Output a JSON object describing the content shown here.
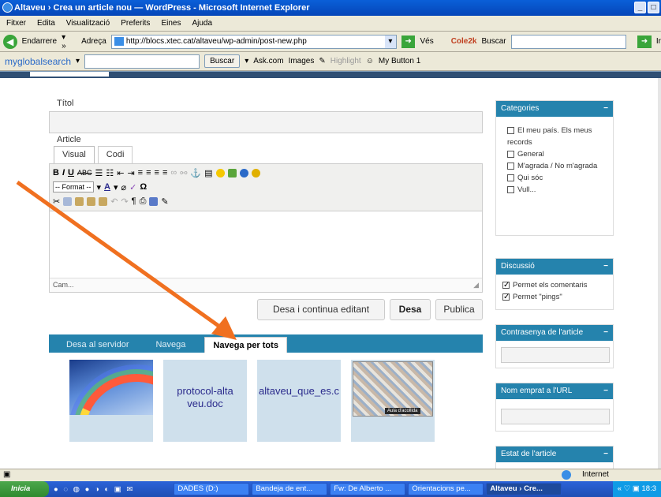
{
  "window": {
    "title": "Altaveu › Crea un article nou — WordPress - Microsoft Internet Explorer"
  },
  "menu": [
    "Fitxer",
    "Edita",
    "Visualització",
    "Preferits",
    "Eines",
    "Ajuda"
  ],
  "toolbar": {
    "back_label": "Endarrere",
    "address_label": "Adreça",
    "address_value": "http://blocs.xtec.cat/altaveu/wp-admin/post-new.php",
    "go_label": "Vés",
    "cole2k_label": "Cole2k",
    "buscar_label": "Buscar",
    "ir_label": "Ir"
  },
  "searchbar": {
    "brand": "myglobalsearch",
    "buscar_button": "Buscar",
    "ask_label": "Ask.com",
    "images_label": "Images",
    "highlight_label": "Highlight",
    "mybutton_label": "My Button 1"
  },
  "editor": {
    "title_label": "Títol",
    "article_label": "Article",
    "tab_visual": "Visual",
    "tab_code": "Codi",
    "format_select": "-- Format --",
    "path_label": "Cam..."
  },
  "actions": {
    "save_continue": "Desa i continua editant",
    "save": "Desa",
    "publish": "Publica"
  },
  "media": {
    "tabs": [
      "Desa al servidor",
      "Navega",
      "Navega per tots"
    ],
    "active_tab": "Navega per tots",
    "items": [
      {
        "kind": "image",
        "label": "",
        "icon": "rainbow-image"
      },
      {
        "kind": "file",
        "label": "protocol-altaveu.doc"
      },
      {
        "kind": "file",
        "label": "altaveu_que_es.c"
      },
      {
        "kind": "image",
        "label": "Aula d'acollida",
        "icon": "classroom-image"
      }
    ]
  },
  "sidebar": {
    "categories": {
      "title": "Categories",
      "items": [
        "El meu país. Els meus records",
        "General",
        "M'agrada / No m'agrada",
        "Qui sóc",
        "Vull..."
      ]
    },
    "discussion": {
      "title": "Discussió",
      "items": [
        {
          "label": "Permet els comentaris",
          "checked": true
        },
        {
          "label": "Permet \"pings\"",
          "checked": true
        }
      ]
    },
    "password": {
      "title": "Contrasenya de l'article"
    },
    "slug": {
      "title": "Nom emprat a l'URL"
    },
    "status": {
      "title": "Estat de l'article"
    }
  },
  "statusbar": {
    "zone": "Internet"
  },
  "taskbar": {
    "start": "Inicia",
    "buttons": [
      "DADES (D:)",
      "Bandeja de ent...",
      "Fw: De Alberto ...",
      "Orientacions pe...",
      "Altaveu › Cre..."
    ],
    "active": "Altaveu › Cre...",
    "clock": "18:3"
  },
  "colors": {
    "wp_blue": "#2583ad",
    "arrow_orange": "#f07020",
    "xp_blue": "#0a5fd8"
  }
}
